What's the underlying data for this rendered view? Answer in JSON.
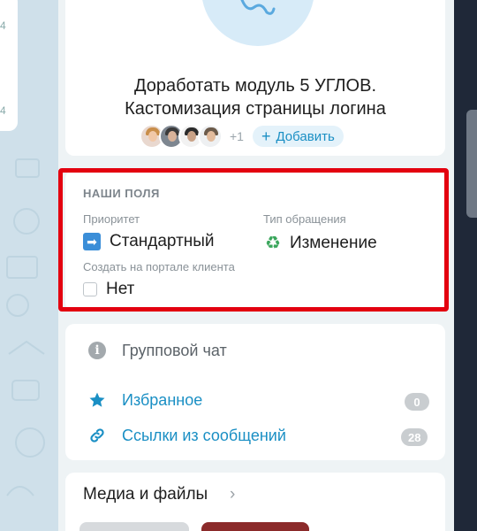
{
  "left_card": {
    "partial_text_1": "4",
    "partial_text_2": "4"
  },
  "task": {
    "title_line1": "Доработать модуль 5 УГЛОВ.",
    "title_line2": "Кастомизация страницы логина",
    "members_more": "+1",
    "add_label": "Добавить"
  },
  "fields": {
    "section_label": "НАШИ ПОЛЯ",
    "priority": {
      "label": "Приоритет",
      "value": "Стандартный",
      "icon": "right-arrow-emoji"
    },
    "request_type": {
      "label": "Тип обращения",
      "value": "Изменение",
      "icon": "recycle-icon"
    },
    "client_portal": {
      "label": "Создать на портале клиента",
      "value": "Нет",
      "checked": false
    }
  },
  "links": {
    "group_chat": "Групповой чат",
    "favorites": {
      "label": "Избранное",
      "count": "0"
    },
    "message_links": {
      "label": "Ссылки из сообщений",
      "count": "28"
    }
  },
  "media": {
    "title": "Медиа и файлы"
  },
  "colors": {
    "accent": "#1a8fc4",
    "highlight_border": "#e3000f",
    "badge": "#c9cdd0"
  }
}
